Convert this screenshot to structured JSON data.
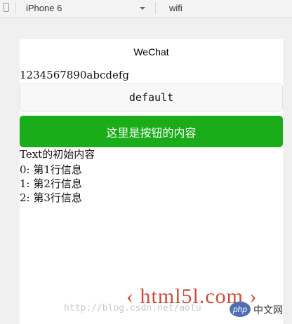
{
  "toolbar": {
    "device": "iPhone 6",
    "network": "wifi"
  },
  "phone": {
    "nav_title": "WeChat",
    "text_line": "1234567890abcdefg",
    "default_button": "default",
    "primary_button": "这里是按钮的内容",
    "initial_text": "Text的初始内容",
    "list_items": [
      "0: 第1行信息",
      "1: 第2行信息",
      "2: 第3行信息"
    ]
  },
  "watermark": {
    "logo": "‹ html5l.com ›",
    "url": "http://blog.csdn.net/aotu",
    "php_badge": "php",
    "cn_text": "中文网"
  }
}
